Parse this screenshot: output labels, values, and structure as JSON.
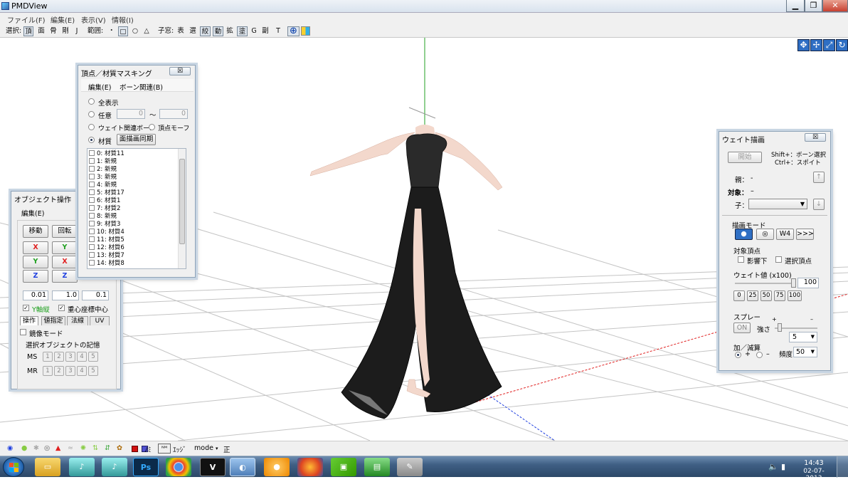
{
  "app": {
    "title": "PMDView"
  },
  "menu": [
    "ファイル(F)",
    "編集(E)",
    "表示(V)",
    "情報(I)"
  ],
  "toolbar": {
    "select_label": "選択:",
    "select_items": [
      "頂",
      "面",
      "骨",
      "剛",
      "J"
    ],
    "range_label": "範囲:",
    "range_items": [
      "・",
      "□",
      "○",
      "△"
    ],
    "child_label": "子窓:",
    "child_items": [
      "表",
      "選",
      "絞",
      "動",
      "拡",
      "塗",
      "G",
      "副",
      "T"
    ]
  },
  "mask_window": {
    "title": "頂点／材質マスキング",
    "close": "☒",
    "menu": [
      "編集(E)",
      "ボーン関連(B)"
    ],
    "show_all": "全表示",
    "arbitrary": "任意",
    "from": "0",
    "tilde": "〜",
    "to": "0",
    "weight_bone": "ウェイト関連ボーン",
    "vertex_morph": "頂点モーフ",
    "material": "材質",
    "sync_btn": "面描画同期",
    "items": [
      "0: 材質11",
      "1: 新規",
      "2: 新規",
      "3: 新規",
      "4: 新規",
      "5: 材質17",
      "6: 材質1",
      "7: 材質2",
      "8: 新規",
      "9: 材質3",
      "10: 材質4",
      "11: 材質5",
      "12: 材質6",
      "13: 材質7",
      "14: 材質8"
    ]
  },
  "object_window": {
    "title": "オブジェクト操作",
    "menu": "編集(E)",
    "move": "移動",
    "rotate": "回転",
    "x": "X",
    "y": "Y",
    "z": "Z",
    "val1": "0.01",
    "val2": "1.0",
    "val3": "0.1",
    "y_lock": "Y軸縦",
    "center": "重心座標中心",
    "tabs": [
      "操作",
      "値指定",
      "法線",
      "UV"
    ],
    "mirror": "鏡像モード",
    "memory": "選択オブジェクトの記憶",
    "ms": "MS",
    "mr": "MR",
    "slots": [
      "1",
      "2",
      "3",
      "4",
      "5"
    ]
  },
  "weight_window": {
    "title": "ウェイト描画",
    "close": "☒",
    "start": "開始",
    "hint1": "Shift+：ボーン選択",
    "hint2": "Ctrl+：スポイト",
    "parent": "親：",
    "parent_val": "-",
    "target": "対象：",
    "target_val": "–",
    "child": "子：",
    "up": "↑",
    "down": "↓",
    "draw_mode": "描画モード",
    "mode_btns": [
      "●",
      "◎",
      "W4",
      ">>>"
    ],
    "target_vertex": "対象頂点",
    "influence": "影響下",
    "selected_vertex": "選択頂点",
    "weight_label": "ウェイト値 (x100)",
    "weight_val": "100",
    "presets": [
      "0",
      "25",
      "50",
      "75",
      "100"
    ],
    "spray": "スプレー",
    "plus": "+",
    "minus": "–",
    "on": "ON",
    "strength": "強さ",
    "strength_val": "5",
    "addsub": "加／減算",
    "freq": "頻度",
    "freq_val": "50"
  },
  "statusbar": {
    "nomi": "ﾉﾐ",
    "edge": "ｴｯｼﾞ",
    "mode": "mode",
    "sei": "正"
  },
  "taskbar": {
    "time": "14:43",
    "date": "02-07-2013"
  },
  "colors": {
    "x_axis": "#e02020",
    "y_axis": "#20a020",
    "z_axis": "#2040e0"
  }
}
